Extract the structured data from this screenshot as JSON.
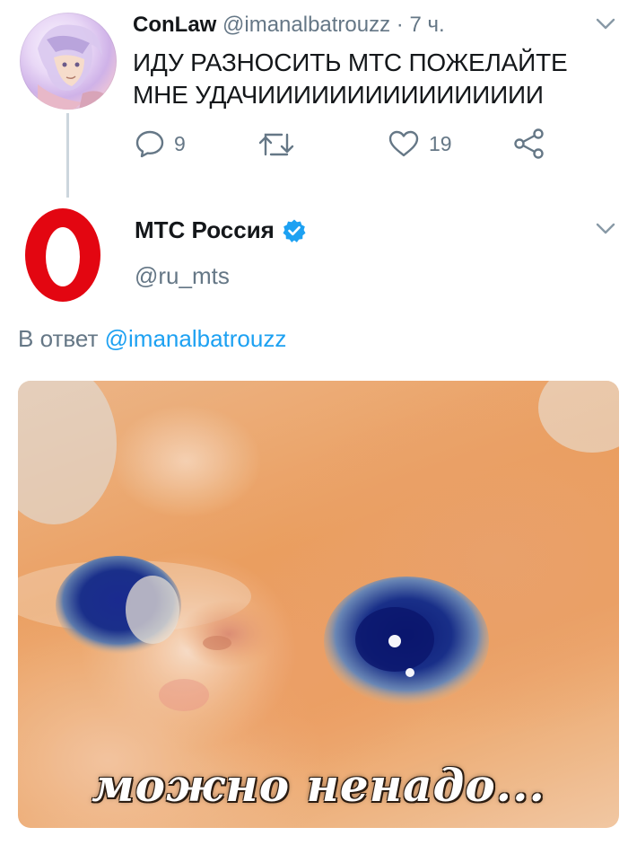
{
  "tweet": {
    "author_name": "ConLaw",
    "author_handle": "@imanalbatrouzz",
    "separator": "·",
    "time": "7 ч.",
    "text_line1": "ИДУ РАЗНОСИТЬ МТС ПОЖЕЛАЙТЕ",
    "text_line2": "МНЕ УДАЧИИИИИИИИИИИИИИИИ",
    "reply_count": "9",
    "like_count": "19"
  },
  "reply": {
    "author_name": "МТС Россия",
    "author_handle": "@ru_mts",
    "reply_prefix": "В ответ",
    "reply_to_handle": "@imanalbatrouzz",
    "image_caption": "можно ненадо..."
  },
  "icons": {
    "reply": "speech-bubble-icon",
    "retweet": "retweet-icon",
    "like": "heart-icon",
    "share": "share-icon",
    "menu": "chevron-down-icon",
    "verified": "verified-badge-icon"
  },
  "colors": {
    "link": "#1da1f2",
    "muted": "#657786",
    "brand_red": "#e30611",
    "verified": "#1da1f2"
  }
}
